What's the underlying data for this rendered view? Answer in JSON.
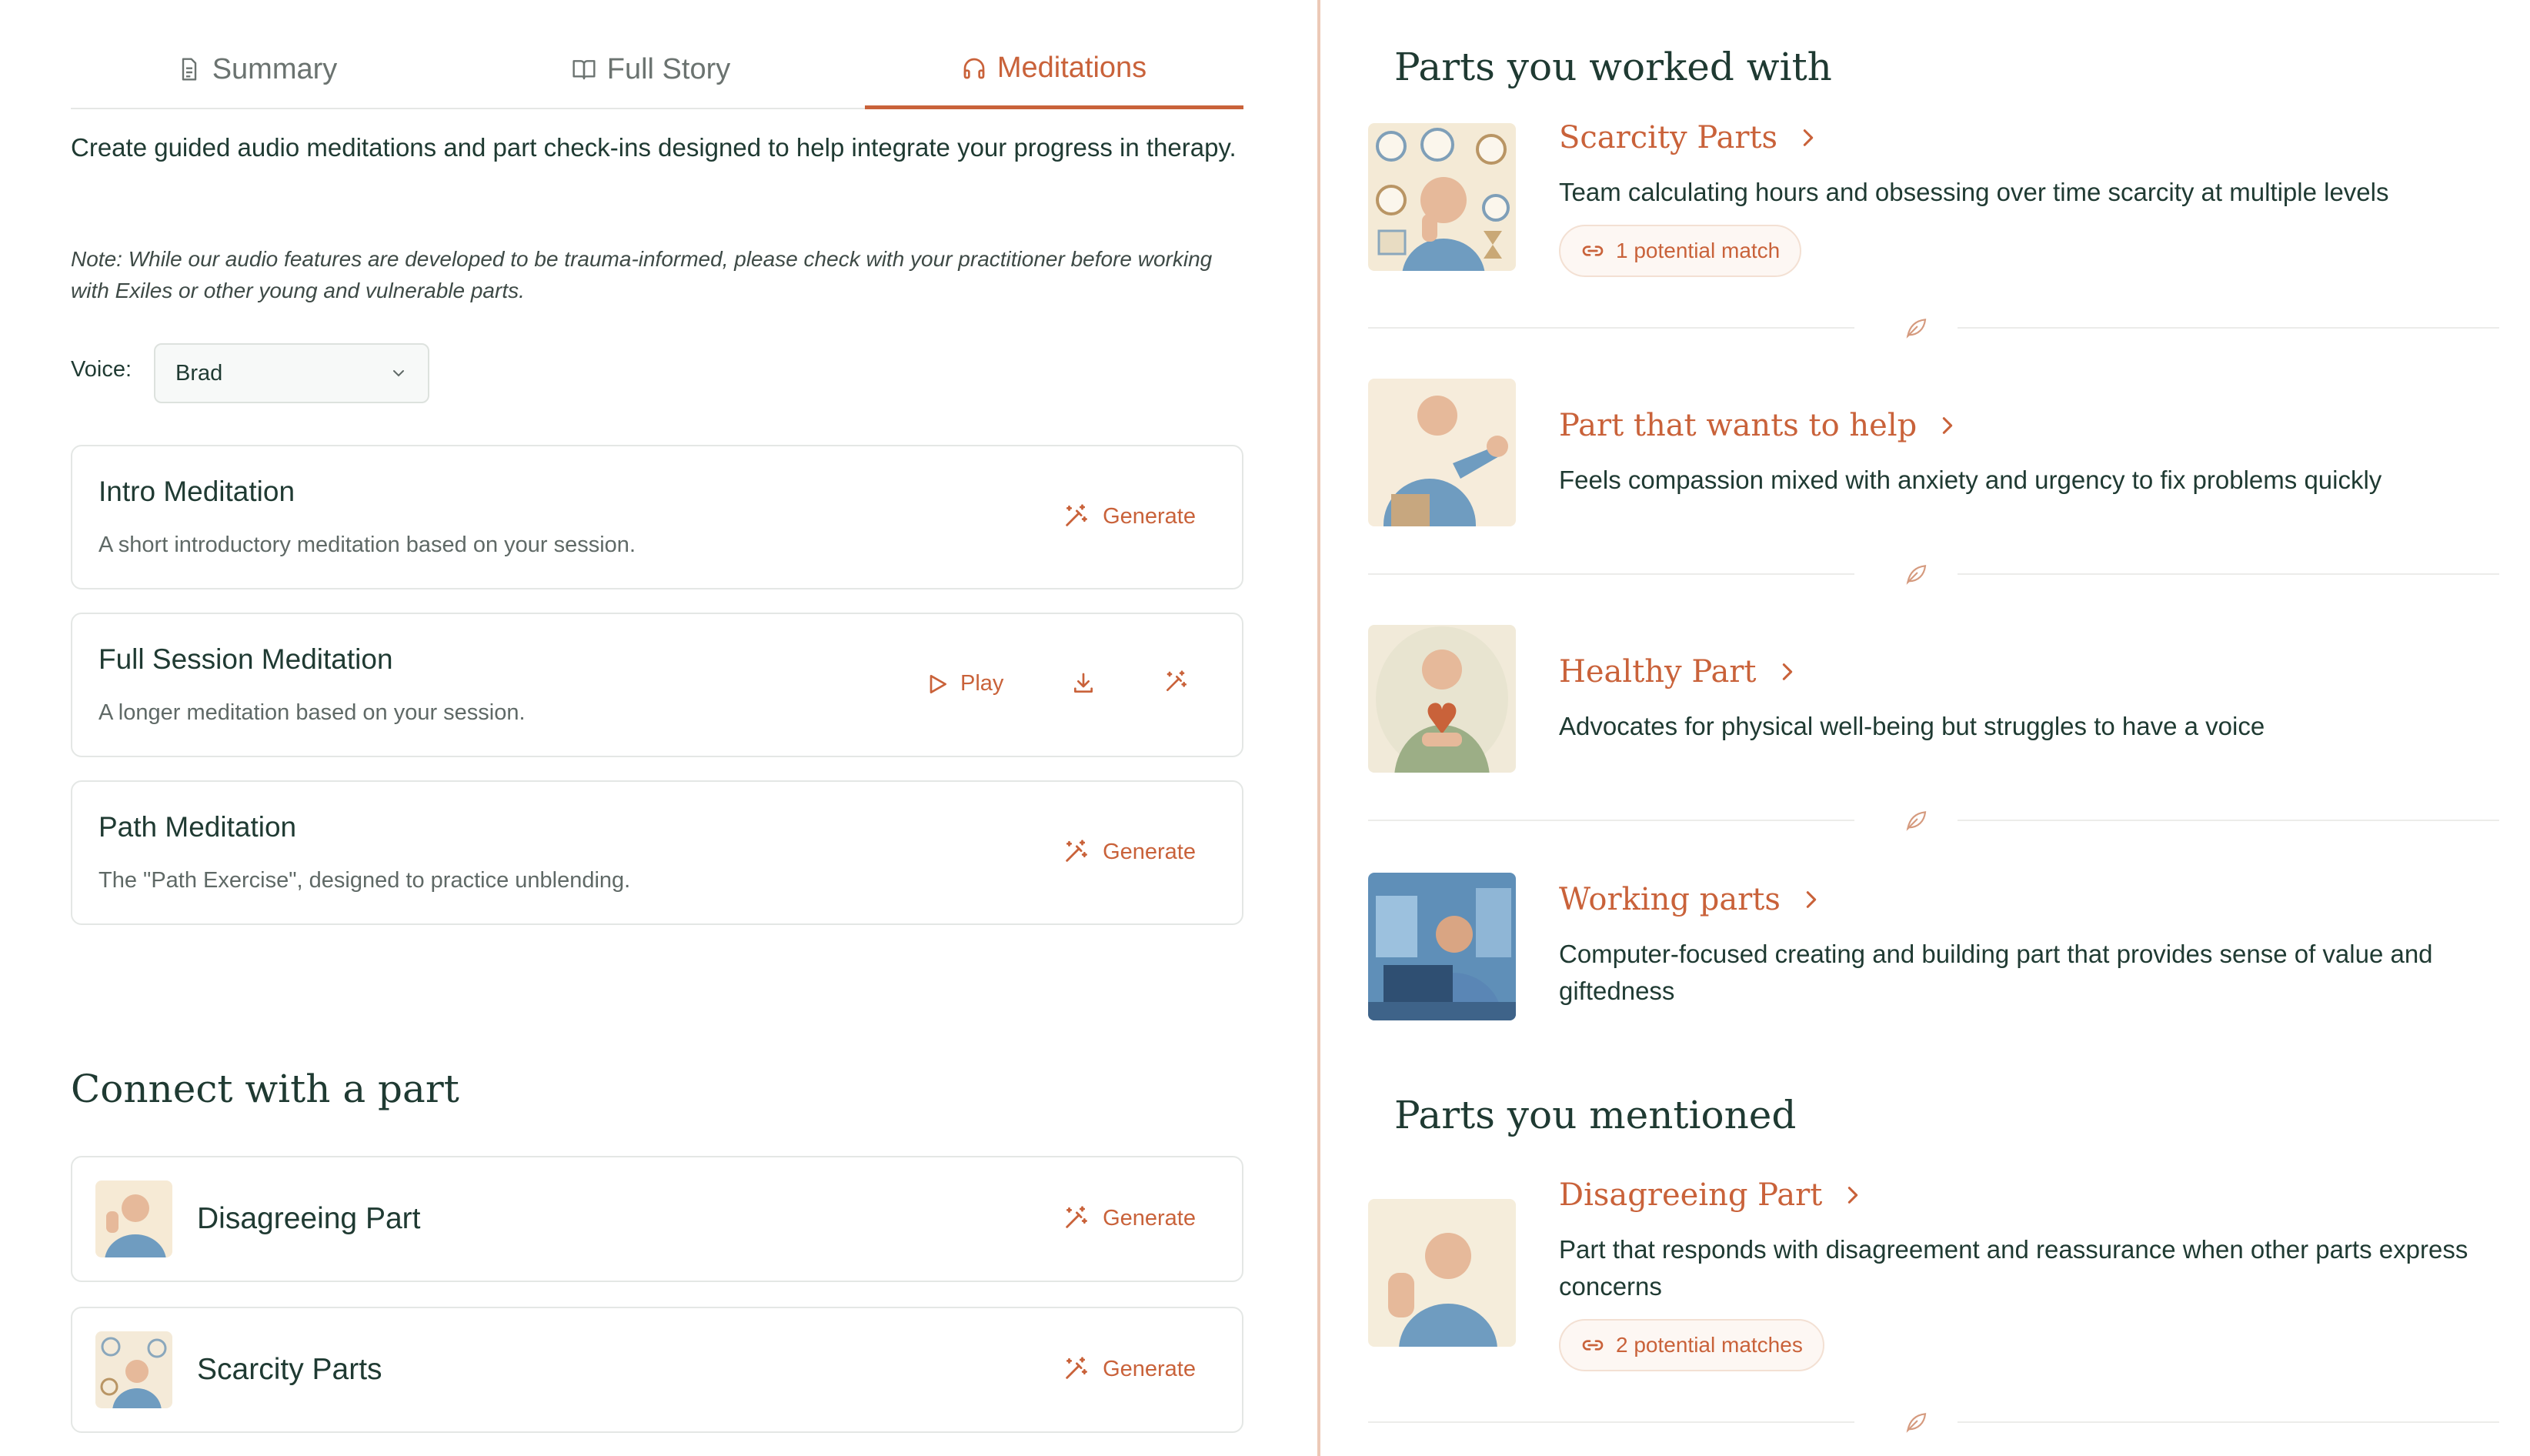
{
  "tabs": [
    {
      "label": "Summary",
      "icon": "document-icon"
    },
    {
      "label": "Full Story",
      "icon": "book-icon"
    },
    {
      "label": "Meditations",
      "icon": "headphones-icon"
    }
  ],
  "meditations": {
    "intro_text": "Create guided audio meditations and part check-ins designed to help integrate your progress in therapy.",
    "note": "Note: While our audio features are developed to be trauma-informed, please check with your practitioner before working with Exiles or other young and vulnerable parts.",
    "voice_label": "Voice:",
    "voice_value": "Brad",
    "cards": [
      {
        "title": "Intro Meditation",
        "desc": "A short introductory meditation based on your session.",
        "action": "Generate"
      },
      {
        "title": "Full Session Meditation",
        "desc": "A longer meditation based on your session.",
        "play": "Play"
      },
      {
        "title": "Path Meditation",
        "desc": "The \"Path Exercise\", designed to practice unblending.",
        "action": "Generate"
      }
    ]
  },
  "connect": {
    "heading": "Connect with a part",
    "parts": [
      {
        "name": "Disagreeing Part",
        "action": "Generate"
      },
      {
        "name": "Scarcity Parts",
        "action": "Generate"
      }
    ]
  },
  "worked_with": {
    "heading": "Parts you worked with",
    "parts": [
      {
        "title": "Scarcity Parts",
        "desc": "Team calculating hours and obsessing over time scarcity at multiple levels",
        "badge": "1 potential match"
      },
      {
        "title": "Part that wants to help",
        "desc": "Feels compassion mixed with anxiety and urgency to fix problems quickly"
      },
      {
        "title": "Healthy Part",
        "desc": "Advocates for physical well-being but struggles to have a voice"
      },
      {
        "title": "Working parts",
        "desc": "Computer-focused creating and building part that provides sense of value and giftedness"
      }
    ]
  },
  "mentioned": {
    "heading": "Parts you mentioned",
    "parts": [
      {
        "title": "Disagreeing Part",
        "desc": "Part that responds with disagreement and reassurance when other parts express concerns",
        "badge": "2 potential matches"
      }
    ]
  },
  "colors": {
    "accent": "#c9623a",
    "text": "#1f3a32",
    "divider": "#ecc9b7"
  }
}
